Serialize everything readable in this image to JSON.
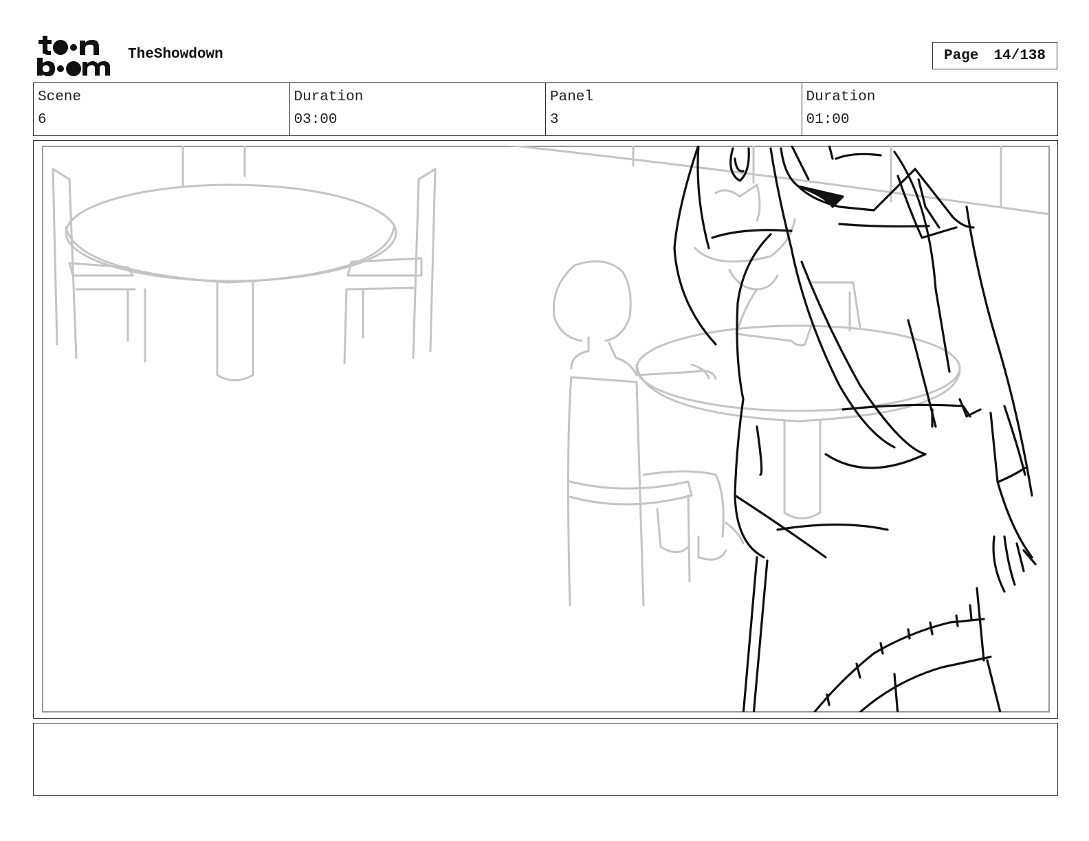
{
  "header": {
    "logo_text": "toonboom",
    "project_title": "TheShowdown",
    "page_label": "Page",
    "page_value": "14/138"
  },
  "info": {
    "scene_label": "Scene",
    "scene_value": "6",
    "scene_duration_label": "Duration",
    "scene_duration_value": "03:00",
    "panel_label": "Panel",
    "panel_value": "3",
    "panel_duration_label": "Duration",
    "panel_duration_value": "01:00"
  },
  "panel": {
    "sketch": "storyboard-sketch-image"
  },
  "notes": {
    "text": ""
  }
}
